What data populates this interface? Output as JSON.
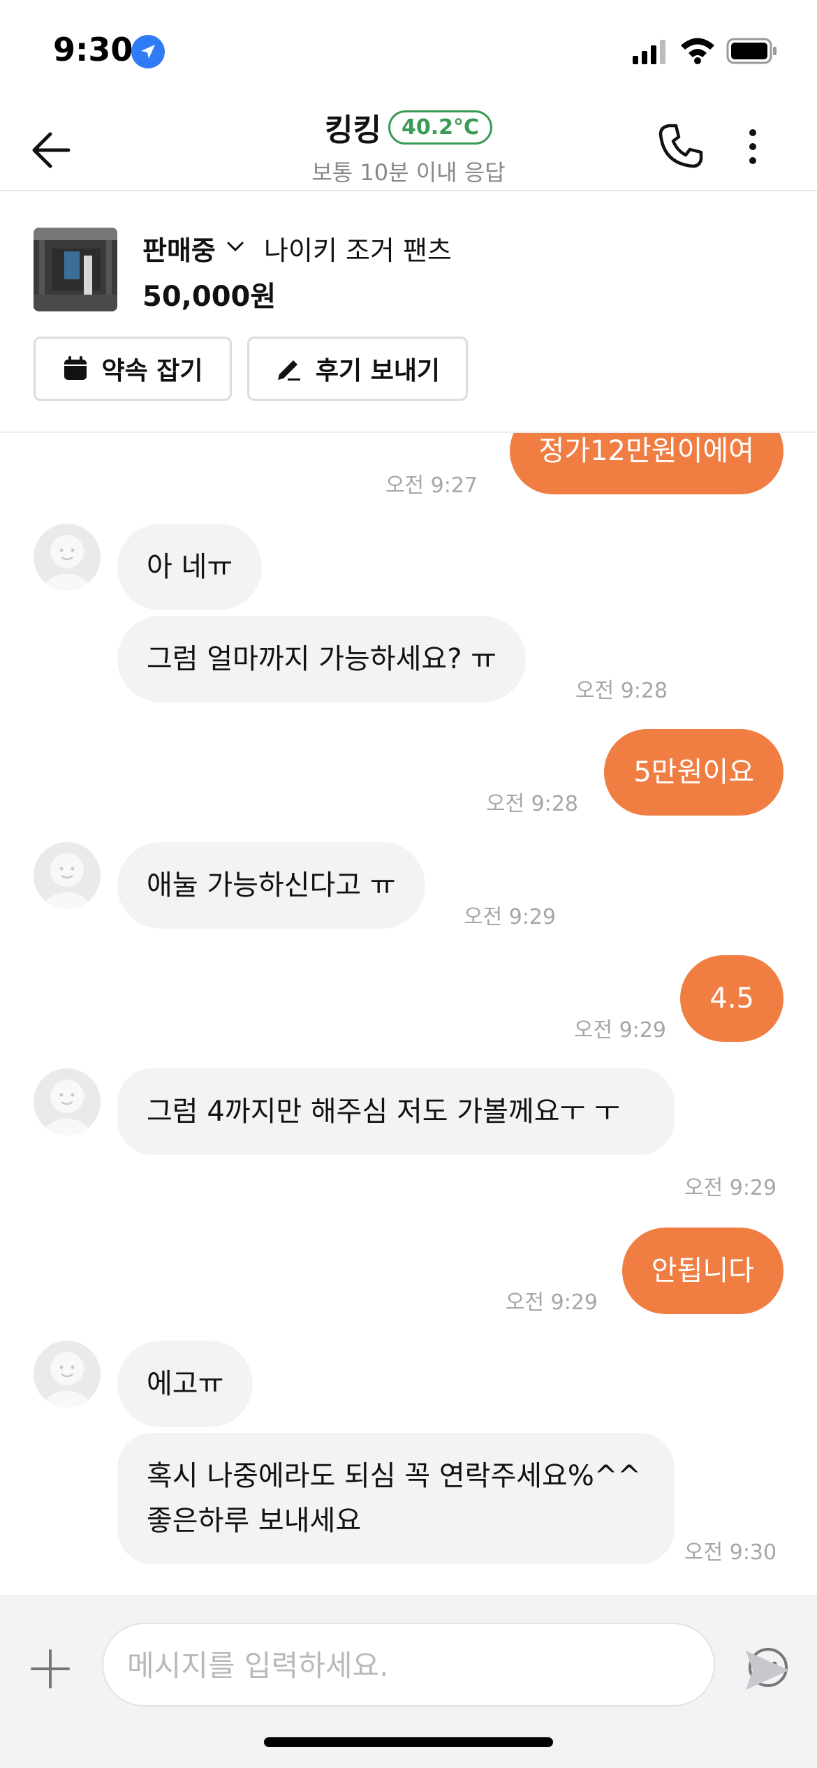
{
  "status_bar": {
    "time": "9:30"
  },
  "header": {
    "title": "킹킹",
    "temperature": "40.2°C",
    "subtitle": "보통 10분 이내 응답"
  },
  "product": {
    "status": "판매중",
    "name": "나이키 조거 팬츠",
    "price": "50,000원",
    "appointment_label": "약속 잡기",
    "review_label": "후기 보내기"
  },
  "messages": [
    {
      "sender": "me",
      "text": "정가12만원이에여",
      "time": "오전 9:27"
    },
    {
      "sender": "other",
      "text": "아 네ㅠ",
      "time": ""
    },
    {
      "sender": "other",
      "text": "그럼 얼마까지 가능하세요? ㅠ",
      "time": "오전 9:28"
    },
    {
      "sender": "me",
      "text": "5만원이요",
      "time": "오전 9:28"
    },
    {
      "sender": "other",
      "text": "애눌 가능하신다고 ㅠ",
      "time": "오전 9:29"
    },
    {
      "sender": "me",
      "text": "4.5",
      "time": "오전 9:29"
    },
    {
      "sender": "other",
      "text": "그럼 4까지만 해주심 저도 가볼께요ㅜ ㅜ",
      "time": "오전 9:29"
    },
    {
      "sender": "me",
      "text": "안됩니다",
      "time": "오전 9:29"
    },
    {
      "sender": "other",
      "text": "에고ㅠ",
      "time": ""
    },
    {
      "sender": "other",
      "text": "혹시 나중에라도 되심 꼭 연락주세요%^^ 좋은하루 보내세요",
      "time": "오전 9:30"
    }
  ],
  "input": {
    "placeholder": "메시지를 입력하세요."
  },
  "colors": {
    "accent": "#f07e43",
    "temp_green": "#3a9a56",
    "bubble_in": "#f2f3f5",
    "time_gray": "#a6a6a6"
  }
}
